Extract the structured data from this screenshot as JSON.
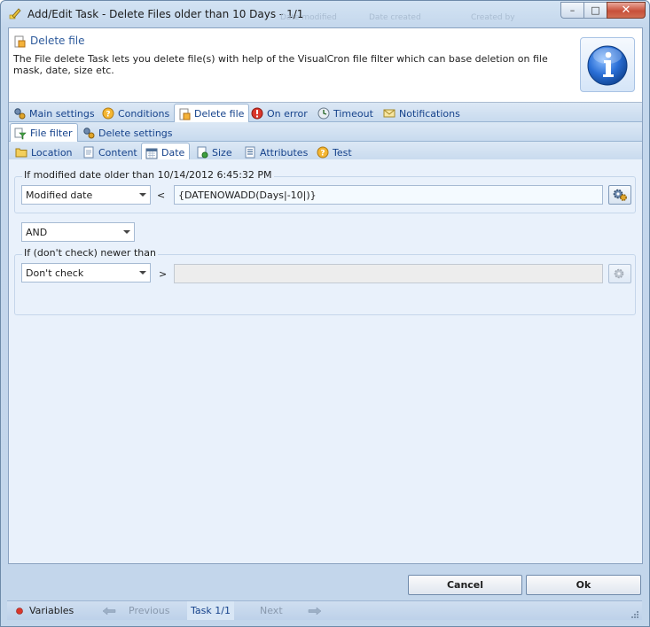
{
  "window": {
    "title": "Add/Edit Task - Delete Files older than 10 Days - 1/1",
    "ghost_columns": [
      "Date modified",
      "Date created",
      "Created by"
    ],
    "buttons": {
      "minimize": "–",
      "maximize": "□",
      "close": "✕"
    }
  },
  "header": {
    "title": "Delete file",
    "description": "The File delete Task lets you delete file(s) with help of the VisualCron file filter which can base deletion on file mask, date, size etc."
  },
  "main_tabs": [
    {
      "label": "Main settings",
      "icon": "gears-icon"
    },
    {
      "label": "Conditions",
      "icon": "question-icon"
    },
    {
      "label": "Delete file",
      "icon": "delete-file-icon",
      "active": true
    },
    {
      "label": "On error",
      "icon": "error-icon"
    },
    {
      "label": "Timeout",
      "icon": "timeout-icon"
    },
    {
      "label": "Notifications",
      "icon": "envelope-icon"
    }
  ],
  "sub_tabs": [
    {
      "label": "File filter",
      "icon": "filter-icon",
      "active": true
    },
    {
      "label": "Delete settings",
      "icon": "gears-icon"
    }
  ],
  "filter_tabs": [
    {
      "label": "Location",
      "icon": "folder-icon"
    },
    {
      "label": "Content",
      "icon": "page-icon"
    },
    {
      "label": "Date",
      "icon": "calendar-icon",
      "active": true
    },
    {
      "label": "Size",
      "icon": "size-icon"
    },
    {
      "label": "Attributes",
      "icon": "attributes-icon"
    },
    {
      "label": "Test",
      "icon": "question-icon"
    }
  ],
  "older": {
    "label": "If modified date older than 10/14/2012 6:45:32 PM",
    "date_type": "Modified date",
    "operator": "<",
    "value": "{DATENOWADD(Days|-10|)}"
  },
  "logic": {
    "value": "AND"
  },
  "newer": {
    "label": "If (don't check) newer than",
    "date_type": "Don't check",
    "operator": ">",
    "value": ""
  },
  "footer": {
    "cancel": "Cancel",
    "ok": "Ok"
  },
  "statusbar": {
    "variables": "Variables",
    "previous": "Previous",
    "task": "Task 1/1",
    "next": "Next"
  },
  "colors": {
    "accent": "#15428b",
    "title_blue": "#2e5b9c",
    "panel": "#e9f1fb"
  }
}
